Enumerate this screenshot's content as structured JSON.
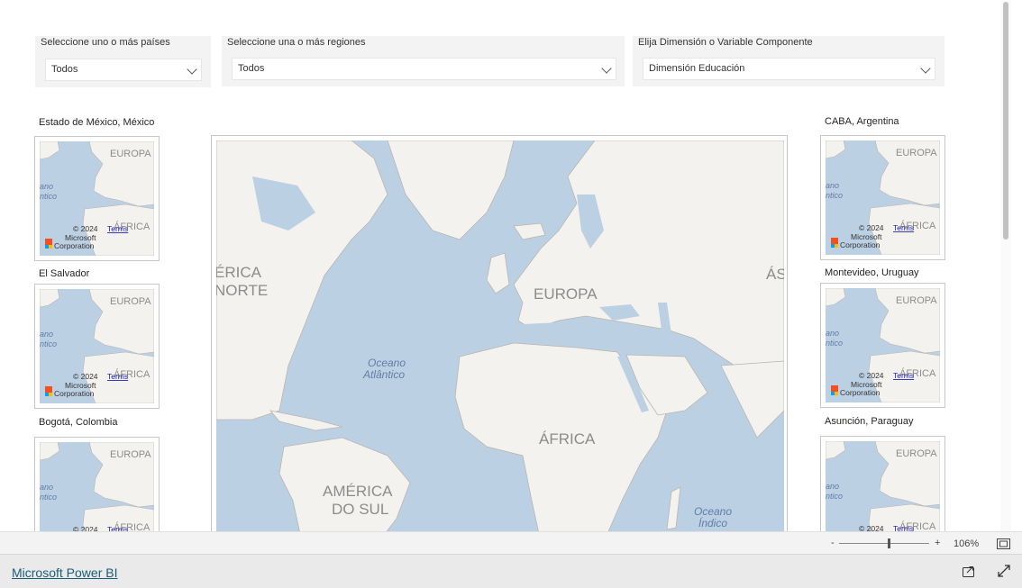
{
  "slicers": [
    {
      "title": "Seleccione uno o más países",
      "value": "Todos"
    },
    {
      "title": "Seleccione una o más regiones",
      "value": "Todos"
    },
    {
      "title": "Elija Dimensión o Variable Componente",
      "value": "Dimensión Educación"
    }
  ],
  "left_maps": [
    {
      "title": "Estado de México, México"
    },
    {
      "title": "El Salvador"
    },
    {
      "title": "Bogotá, Colombia"
    }
  ],
  "right_maps": [
    {
      "title": "CABA, Argentina"
    },
    {
      "title": "Montevideo, Uruguay"
    },
    {
      "title": "Asunción, Paraguay"
    }
  ],
  "mini_map_labels": {
    "europa": "EUROPA",
    "africa": "ÁFRICA",
    "ocean_1": "ano",
    "ocean_2": "ntico",
    "copyright": "© 2024",
    "terms": "Terms",
    "vendor_1": "Microsoft",
    "vendor_2": "Corporation"
  },
  "main_map_labels": {
    "america_norte_1": "ÉRICA",
    "america_norte_2": "NORTE",
    "europa": "EUROPA",
    "asia": "ÁS",
    "oceano_atlantico_1": "Oceano",
    "oceano_atlantico_2": "Atlântico",
    "africa": "ÁFRICA",
    "america_sul_1": "AMÉRICA",
    "america_sul_2": "DO SUL",
    "oceano_indico_1": "Oceano",
    "oceano_indico_2": "Índico"
  },
  "zoom": {
    "minus": "-",
    "plus": "+",
    "level": "106%",
    "fraction": 0.55
  },
  "footer": {
    "link": "Microsoft Power BI"
  },
  "colors": {
    "water": "#bcd0e4",
    "land": "#f4f2ef",
    "border": "#b9b5b0",
    "link": "#1a5e75"
  }
}
